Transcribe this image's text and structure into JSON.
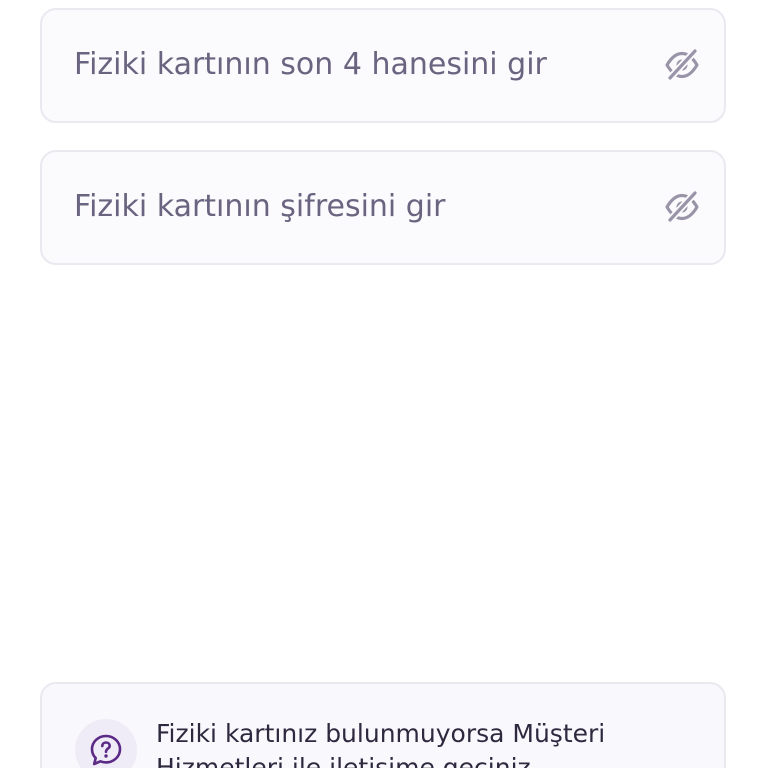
{
  "form": {
    "last_four_field": {
      "placeholder": "Fiziki kartının son 4 hanesini gir",
      "value": "",
      "toggle_icon": "eye-off-icon"
    },
    "pin_field": {
      "placeholder": "Fiziki kartının şifresini gir",
      "value": "",
      "toggle_icon": "eye-off-icon"
    }
  },
  "info": {
    "icon": "help-circle-icon",
    "text": "Fiziki kartınız bulunmuyorsa Müşteri Hizmetleri ile iletişime geçiniz."
  },
  "colors": {
    "field_border": "#ebe9f0",
    "placeholder_text": "#6b6480",
    "icon_gray": "#9a94a8",
    "accent_purple": "#5b2a86",
    "info_text": "#2f2940"
  }
}
